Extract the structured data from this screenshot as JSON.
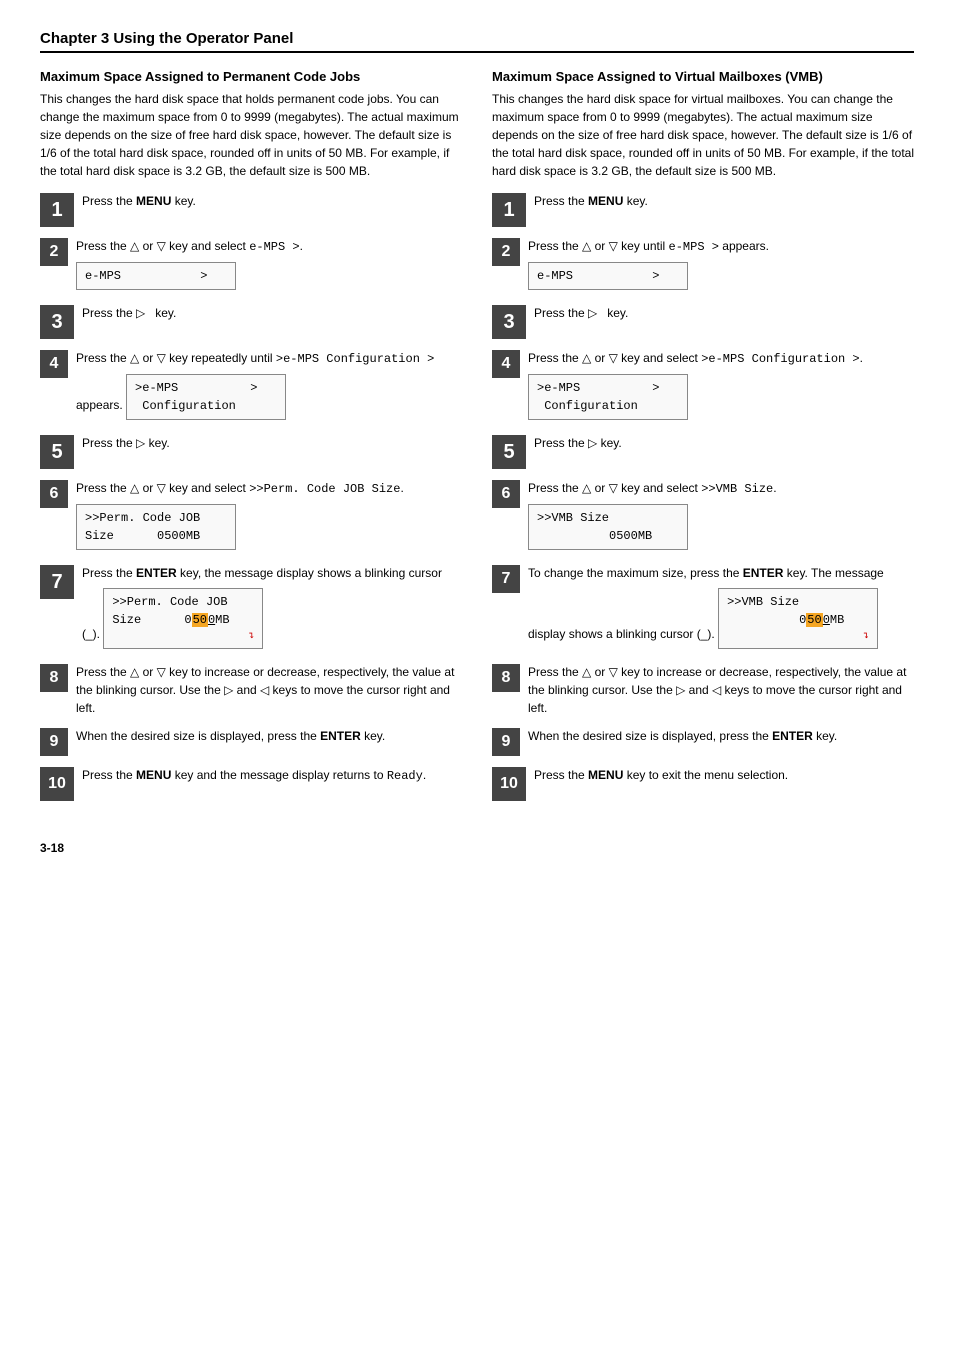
{
  "chapter_title": "Chapter 3  Using the Operator Panel",
  "page_number": "3-18",
  "left_section": {
    "title": "Maximum Space Assigned to Permanent Code Jobs",
    "description": "This changes the hard disk space that holds permanent code jobs. You can change the maximum space from 0 to 9999 (megabytes). The actual maximum size depends on the size of free hard disk space, however. The default size is 1/6 of the total hard disk space, rounded off in units of 50 MB. For example, if the total hard disk space is 3.2 GB, the default size is 500 MB.",
    "steps": [
      {
        "num": "1",
        "large": true,
        "text": "Press the <b>MENU</b> key.",
        "lcd": null
      },
      {
        "num": "2",
        "large": false,
        "text": "Press the △ or ▽ key and select <code>e-MPS &gt;</code>.",
        "lcd": {
          "rows": [
            "e-MPS           >"
          ]
        }
      },
      {
        "num": "3",
        "large": true,
        "text": "Press the ▷   key.",
        "lcd": null
      },
      {
        "num": "4",
        "large": false,
        "text": "Press the △ or ▽ key repeatedly until <code>&gt;e-MPS Configuration &gt;</code> appears.",
        "lcd": {
          "rows": [
            ">e-MPS          >",
            " Configuration"
          ]
        }
      },
      {
        "num": "5",
        "large": true,
        "text": "Press the ▷ key.",
        "lcd": null
      },
      {
        "num": "6",
        "large": false,
        "text": "Press the △ or ▽ key and select <code>&gt;&gt;Perm. Code JOB Size</code>.",
        "lcd": {
          "rows": [
            ">>Perm. Code JOB",
            "Size      0500MB"
          ]
        }
      },
      {
        "num": "7",
        "large": true,
        "text": "Press the <b>ENTER</b> key, the message display shows a blinking cursor (_).",
        "lcd_cursor": true,
        "lcd": {
          "rows": [
            ">>Perm. Code JOB",
            "Size      0500MB"
          ]
        }
      },
      {
        "num": "8",
        "large": false,
        "text": "Press the △ or ▽ key to increase or decrease, respectively, the value at the blinking cursor. Use the ▷ and ◁ keys to move the cursor right and left.",
        "lcd": null
      },
      {
        "num": "9",
        "large": false,
        "text": "When the desired size is displayed, press the <b>ENTER</b> key.",
        "lcd": null
      },
      {
        "num": "10",
        "large": true,
        "text": "Press the <b>MENU</b> key and the message display returns to <code>Ready</code>.",
        "lcd": null
      }
    ]
  },
  "right_section": {
    "title": "Maximum Space Assigned to Virtual Mailboxes (VMB)",
    "description": "This changes the hard disk space for virtual mailboxes. You can change the maximum space from 0 to 9999 (megabytes). The actual maximum size depends on the size of free hard disk space, however. The default size is 1/6 of the total hard disk space, rounded off in units of 50 MB. For example, if the total hard disk space is 3.2 GB, the default size is 500 MB.",
    "steps": [
      {
        "num": "1",
        "large": true,
        "text": "Press the <b>MENU</b> key.",
        "lcd": null
      },
      {
        "num": "2",
        "large": false,
        "text": "Press the △ or ▽ key until <code>e-MPS &gt;</code> appears.",
        "lcd": {
          "rows": [
            "e-MPS           >"
          ]
        }
      },
      {
        "num": "3",
        "large": true,
        "text": "Press the ▷   key.",
        "lcd": null
      },
      {
        "num": "4",
        "large": false,
        "text": "Press the △ or ▽ key and select <code>&gt;e-MPS Configuration &gt;</code>.",
        "lcd": {
          "rows": [
            ">e-MPS          >",
            " Configuration"
          ]
        }
      },
      {
        "num": "5",
        "large": true,
        "text": "Press the ▷ key.",
        "lcd": null
      },
      {
        "num": "6",
        "large": false,
        "text": "Press the △ or ▽ key and select <code>&gt;&gt;VMB Size</code>.",
        "lcd": {
          "rows": [
            ">>VMB Size",
            "          0500MB"
          ]
        }
      },
      {
        "num": "7",
        "large": false,
        "text": "To change the maximum size, press the <b>ENTER</b> key. The message display shows a blinking cursor (_).",
        "lcd_cursor": true,
        "lcd": {
          "rows": [
            ">>VMB Size",
            "          0500MB"
          ]
        }
      },
      {
        "num": "8",
        "large": false,
        "text": "Press the △ or ▽ key to increase or decrease, respectively, the value at the blinking cursor. Use the ▷ and ◁ keys to move the cursor right and left.",
        "lcd": null
      },
      {
        "num": "9",
        "large": false,
        "text": "When the desired size is displayed, press the <b>ENTER</b> key.",
        "lcd": null
      },
      {
        "num": "10",
        "large": true,
        "text": "Press the <b>MENU</b> key to exit the menu selection.",
        "lcd": null
      }
    ]
  }
}
